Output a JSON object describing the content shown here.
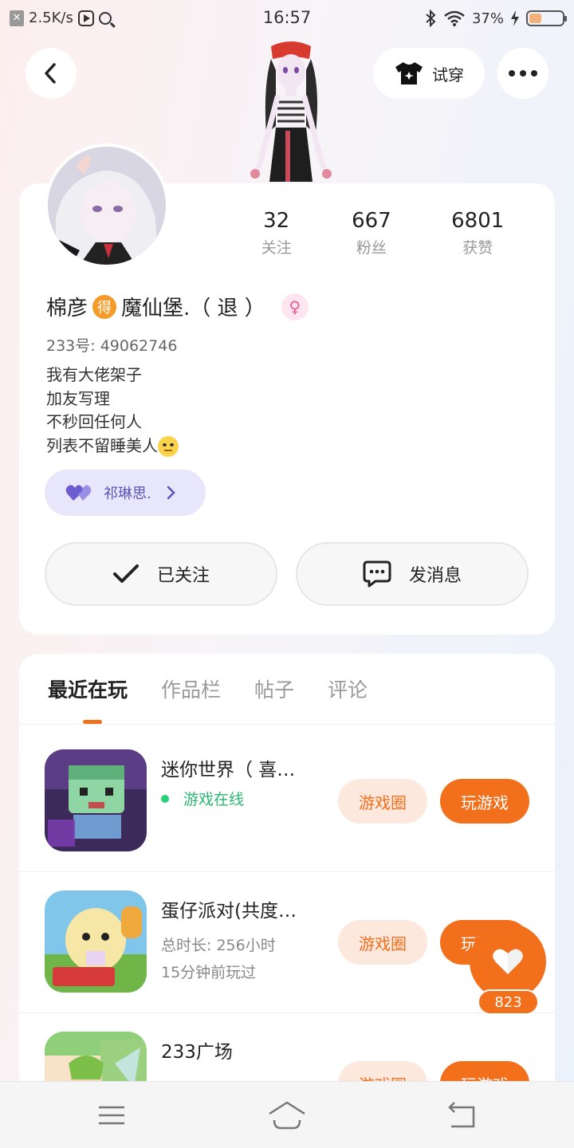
{
  "status_bar": {
    "net_speed": "2.5K/s",
    "time": "16:57",
    "battery": "37%",
    "battery_level": 0.37
  },
  "header": {
    "tryon_label": "试穿"
  },
  "profile": {
    "stats": [
      {
        "value": "32",
        "label": "关注"
      },
      {
        "value": "667",
        "label": "粉丝"
      },
      {
        "value": "6801",
        "label": "获赞"
      }
    ],
    "name_part1": "棉彦",
    "name_badge": "得",
    "name_part2": "魔仙堡.（ 退 ）",
    "uid": "233号: 49062746",
    "bio": [
      "我有大佬架子",
      "加友写理",
      "不秒回任何人",
      "列表不留睡美人"
    ],
    "cp_name": "祁琳思.",
    "follow_label": "已关注",
    "message_label": "发消息"
  },
  "tabs": [
    {
      "label": "最近在玩",
      "active": true
    },
    {
      "label": "作品栏",
      "active": false
    },
    {
      "label": "帖子",
      "active": false
    },
    {
      "label": "评论",
      "active": false
    }
  ],
  "games": [
    {
      "name": "迷你世界（ 喜…",
      "status": "游戏在线",
      "circle_label": "游戏圈",
      "play_label": "玩游戏"
    },
    {
      "name": "蛋仔派对(共度…",
      "duration": "总时长: 256小时",
      "last_played": "15分钟前玩过",
      "circle_label": "游戏圈",
      "play_label": "玩游戏"
    },
    {
      "name": "233广场",
      "circle_label": "游戏圈",
      "play_label": "玩游戏"
    }
  ],
  "like_count": "823",
  "colors": {
    "accent": "#f26f1c",
    "accent_light": "#fde8dd",
    "online": "#2bb673",
    "cp_bg": "#e8e6fb",
    "cp_text": "#5a55b8"
  }
}
